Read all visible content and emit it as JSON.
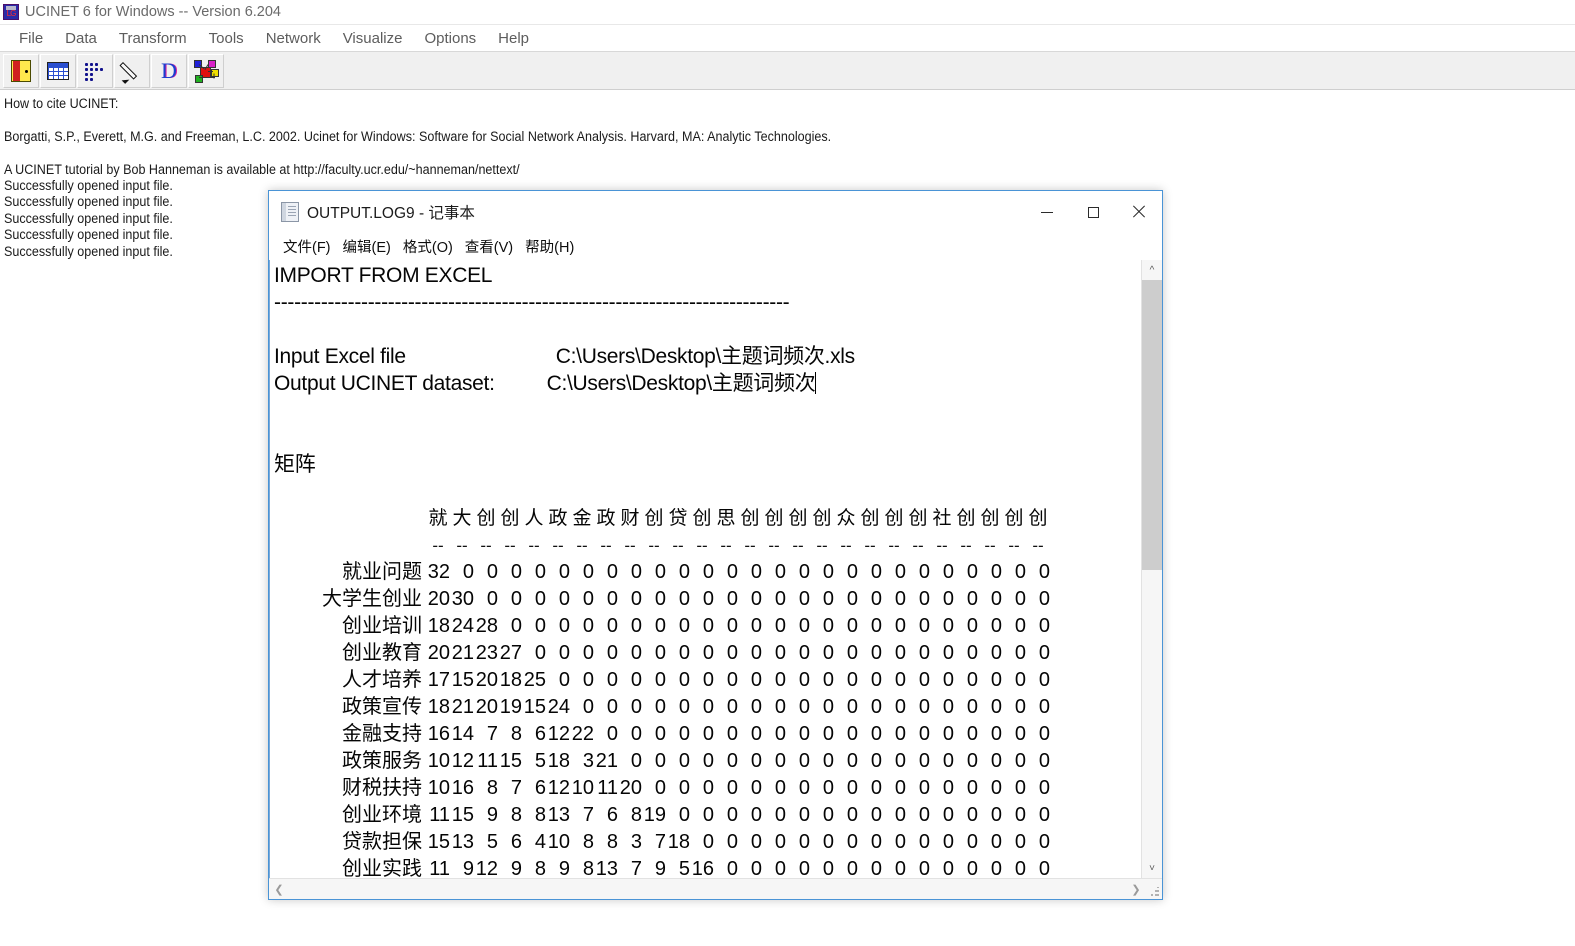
{
  "ucinet": {
    "title": "UCINET 6 for Windows -- Version 6.204",
    "app_icon": "ucinet-logo-icon",
    "menu": [
      {
        "label": "File"
      },
      {
        "label": "Data"
      },
      {
        "label": "Transform"
      },
      {
        "label": "Tools"
      },
      {
        "label": "Network"
      },
      {
        "label": "Visualize"
      },
      {
        "label": "Options"
      },
      {
        "label": "Help"
      }
    ],
    "toolbar": [
      {
        "icon": "exit-door-icon"
      },
      {
        "icon": "spreadsheet-icon"
      },
      {
        "icon": "matrix-dots-icon"
      },
      {
        "icon": "pencil-icon"
      },
      {
        "icon": "letter-d-icon"
      },
      {
        "icon": "network-graph-icon"
      }
    ],
    "log_lines": [
      "How to cite UCINET:",
      "",
      "Borgatti, S.P., Everett, M.G. and Freeman, L.C. 2002. Ucinet for Windows: Software for Social Network Analysis. Harvard, MA: Analytic Technologies.",
      "",
      "A UCINET tutorial by Bob Hanneman is available at http://faculty.ucr.edu/~hanneman/nettext/",
      "Successfully opened input file.",
      "Successfully opened input file.",
      "Successfully opened input file.",
      "Successfully opened input file.",
      "Successfully opened input file."
    ]
  },
  "notepad": {
    "title": "OUTPUT.LOG9 - 记事本",
    "icon": "notepad-icon",
    "window_buttons": {
      "minimize": "minimize-icon",
      "maximize": "maximize-icon",
      "close": "close-icon"
    },
    "menu": [
      {
        "label": "文件(F)"
      },
      {
        "label": "编辑(E)"
      },
      {
        "label": "格式(O)"
      },
      {
        "label": "查看(V)"
      },
      {
        "label": "帮助(H)"
      }
    ],
    "content": {
      "heading": "IMPORT FROM EXCEL",
      "rule": "-----------------------------------------------------------------------------",
      "input_label": "Input Excel file",
      "input_value": "C:\\Users\\Desktop\\主题词频次.xls",
      "output_label": "Output UCINET dataset:",
      "output_value": "C:\\Users\\Desktop\\主题词频次",
      "matrix_title": "矩阵"
    },
    "scrollbars": {
      "v_up": "scroll-up-icon",
      "v_down": "scroll-down-icon",
      "h_left": "scroll-left-icon",
      "h_right": "scroll-right-icon",
      "resize_grip": "resize-grip-icon"
    }
  },
  "chart_data": {
    "type": "table",
    "title": "矩阵",
    "col_headers": [
      "就",
      "大",
      "创",
      "创",
      "人",
      "政",
      "金",
      "政",
      "财",
      "创",
      "贷",
      "创",
      "思",
      "创",
      "创",
      "创",
      "创",
      "众",
      "创",
      "创",
      "创",
      "社",
      "创",
      "创",
      "创",
      "创"
    ],
    "row_labels": [
      "就业问题",
      "大学生创业",
      "创业培训",
      "创业教育",
      "人才培养",
      "政策宣传",
      "金融支持",
      "政策服务",
      "财税扶持",
      "创业环境",
      "贷款担保",
      "创业实践"
    ],
    "rows": [
      [
        32,
        0,
        0,
        0,
        0,
        0,
        0,
        0,
        0,
        0,
        0,
        0,
        0,
        0,
        0,
        0,
        0,
        0,
        0,
        0,
        0,
        0,
        0,
        0,
        0,
        0
      ],
      [
        20,
        30,
        0,
        0,
        0,
        0,
        0,
        0,
        0,
        0,
        0,
        0,
        0,
        0,
        0,
        0,
        0,
        0,
        0,
        0,
        0,
        0,
        0,
        0,
        0,
        0
      ],
      [
        18,
        24,
        28,
        0,
        0,
        0,
        0,
        0,
        0,
        0,
        0,
        0,
        0,
        0,
        0,
        0,
        0,
        0,
        0,
        0,
        0,
        0,
        0,
        0,
        0,
        0
      ],
      [
        20,
        21,
        23,
        27,
        0,
        0,
        0,
        0,
        0,
        0,
        0,
        0,
        0,
        0,
        0,
        0,
        0,
        0,
        0,
        0,
        0,
        0,
        0,
        0,
        0,
        0
      ],
      [
        17,
        15,
        20,
        18,
        25,
        0,
        0,
        0,
        0,
        0,
        0,
        0,
        0,
        0,
        0,
        0,
        0,
        0,
        0,
        0,
        0,
        0,
        0,
        0,
        0,
        0
      ],
      [
        18,
        21,
        20,
        19,
        15,
        24,
        0,
        0,
        0,
        0,
        0,
        0,
        0,
        0,
        0,
        0,
        0,
        0,
        0,
        0,
        0,
        0,
        0,
        0,
        0,
        0
      ],
      [
        16,
        14,
        7,
        8,
        6,
        12,
        22,
        0,
        0,
        0,
        0,
        0,
        0,
        0,
        0,
        0,
        0,
        0,
        0,
        0,
        0,
        0,
        0,
        0,
        0,
        0
      ],
      [
        10,
        12,
        11,
        15,
        5,
        18,
        3,
        21,
        0,
        0,
        0,
        0,
        0,
        0,
        0,
        0,
        0,
        0,
        0,
        0,
        0,
        0,
        0,
        0,
        0,
        0
      ],
      [
        10,
        16,
        8,
        7,
        6,
        12,
        10,
        11,
        20,
        0,
        0,
        0,
        0,
        0,
        0,
        0,
        0,
        0,
        0,
        0,
        0,
        0,
        0,
        0,
        0,
        0
      ],
      [
        11,
        15,
        9,
        8,
        8,
        13,
        7,
        6,
        8,
        19,
        0,
        0,
        0,
        0,
        0,
        0,
        0,
        0,
        0,
        0,
        0,
        0,
        0,
        0,
        0,
        0
      ],
      [
        15,
        13,
        5,
        6,
        4,
        10,
        8,
        8,
        3,
        7,
        18,
        0,
        0,
        0,
        0,
        0,
        0,
        0,
        0,
        0,
        0,
        0,
        0,
        0,
        0,
        0
      ],
      [
        11,
        9,
        12,
        9,
        8,
        9,
        8,
        13,
        7,
        9,
        5,
        16,
        0,
        0,
        0,
        0,
        0,
        0,
        0,
        0,
        0,
        0,
        0,
        0,
        0,
        0
      ]
    ],
    "xlabel": "",
    "ylabel": "",
    "grid": false,
    "legend": "none"
  }
}
